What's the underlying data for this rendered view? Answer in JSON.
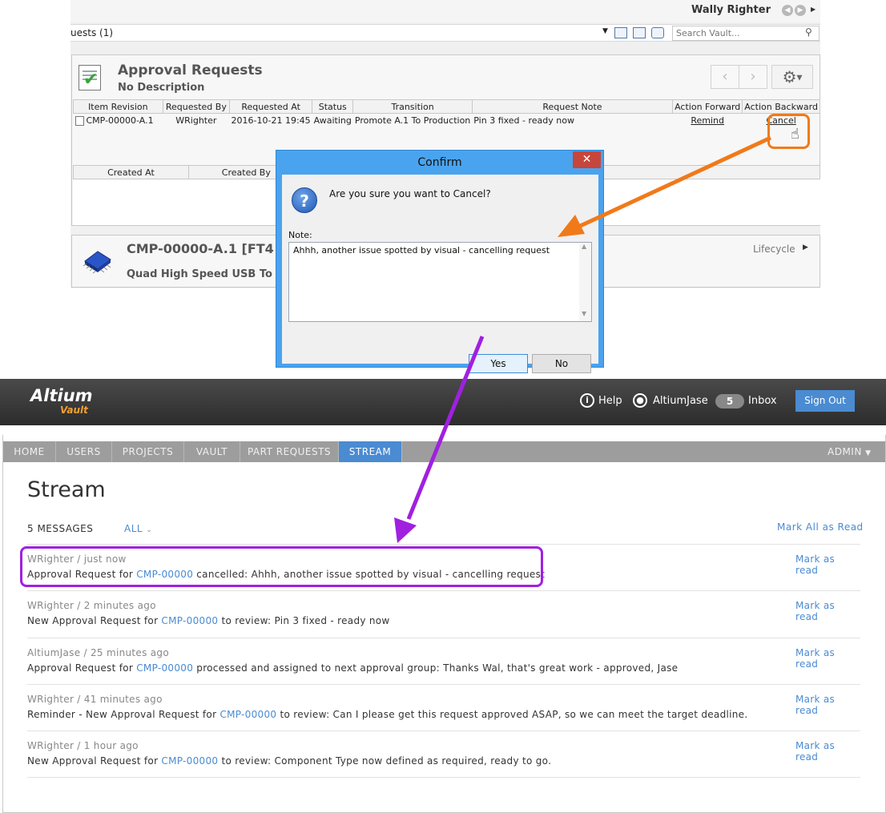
{
  "desktop": {
    "user_name": "Wally Righter",
    "path_text": "uests (1)",
    "search_placeholder": "Search Vault...",
    "panel": {
      "title": "Approval Requests",
      "description": "No Description"
    },
    "requests_table": {
      "columns": [
        "Item Revision",
        "Requested By",
        "Requested At",
        "Status",
        "Transition",
        "Request Note",
        "Action Forward",
        "Action Backward"
      ],
      "rows": [
        {
          "item_revision": "CMP-00000-A.1",
          "requested_by": "WRighter",
          "requested_at": "2016-10-21 19:45",
          "status": "Awaiting",
          "transition": "Promote A.1 To Production",
          "request_note": "Pin 3 fixed - ready now",
          "action_forward": "Remind",
          "action_backward": "Cancel"
        }
      ]
    },
    "history_table": {
      "columns": [
        "Created At",
        "Created By"
      ]
    },
    "component": {
      "title": "CMP-00000-A.1 [FT4",
      "description": "Quad High Speed USB To Mu",
      "lifecycle_label": "Lifecycle"
    }
  },
  "dialog": {
    "title": "Confirm",
    "close_glyph": "✕",
    "question_glyph": "?",
    "message": "Are you sure you want to Cancel?",
    "note_label": "Note:",
    "note_value": "Ahhh, another issue spotted by visual - cancelling request",
    "yes_label": "Yes",
    "no_label": "No"
  },
  "web": {
    "logo": "Altium",
    "logo_sub": "Vault",
    "help_label": "Help",
    "user_label": "AltiumJase",
    "inbox_count": "5",
    "inbox_label": "Inbox",
    "signout_label": "Sign Out",
    "nav": {
      "tabs": [
        "HOME",
        "USERS",
        "PROJECTS",
        "VAULT",
        "PART REQUESTS",
        "STREAM"
      ],
      "active": "STREAM",
      "admin_label": "ADMIN"
    },
    "stream": {
      "title": "Stream",
      "message_count": "5 MESSAGES",
      "filter_label": "ALL",
      "mark_all_label": "Mark All as Read",
      "mark_label": "Mark as read",
      "messages": [
        {
          "meta": "WRighter / just now",
          "pre": "Approval Request for ",
          "link": "CMP-00000",
          "post": " cancelled: Ahhh, another issue spotted by visual - cancelling request"
        },
        {
          "meta": "WRighter / 2 minutes ago",
          "pre": "New Approval Request for ",
          "link": "CMP-00000",
          "post": " to review: Pin 3 fixed - ready now"
        },
        {
          "meta": "AltiumJase / 25 minutes ago",
          "pre": "Approval Request for ",
          "link": "CMP-00000",
          "post": " processed and assigned to next approval group: Thanks Wal, that's great work - approved, Jase"
        },
        {
          "meta": "WRighter / 41 minutes ago",
          "pre": "Reminder - New Approval Request for ",
          "link": "CMP-00000",
          "post": " to review: Can I please get this request approved ASAP, so we can meet the target deadline."
        },
        {
          "meta": "WRighter / 1 hour ago",
          "pre": "New Approval Request for ",
          "link": "CMP-00000",
          "post": " to review: Component Type now defined as required, ready to go."
        }
      ]
    }
  },
  "colors": {
    "highlight_orange": "#f07a1a",
    "highlight_purple": "#a020e0",
    "link_blue": "#4a8bd2"
  }
}
